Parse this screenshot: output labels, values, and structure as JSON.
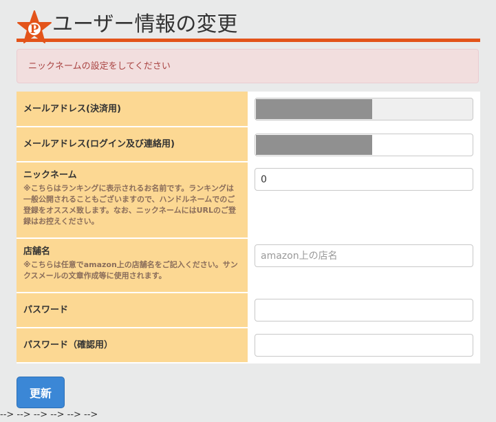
{
  "header": {
    "logo_letter": "P",
    "title": "ユーザー情報の変更"
  },
  "alert": {
    "message": "ニックネームの設定をしてください"
  },
  "form": {
    "rows": [
      {
        "label": "メールアドレス(決済用)",
        "note": "",
        "value": "",
        "placeholder": ""
      },
      {
        "label": "メールアドレス(ログイン及び連絡用)",
        "note": "",
        "value": "",
        "placeholder": ""
      },
      {
        "label": "ニックネーム",
        "note": "※こちらはランキングに表示されるお名前です。ランキングは一般公開されることもございますので、ハンドルネームでのご登録をオススメ致します。なお、ニックネームにはURLのご登録はお控えください。",
        "value": "0",
        "placeholder": ""
      },
      {
        "label": "店舗名",
        "note": "※こちらは任意でamazon上の店舗名をご記入ください。サンクスメールの文章作成等に使用されます。",
        "value": "",
        "placeholder": "amazon上の店名"
      },
      {
        "label": "パスワード",
        "note": "",
        "value": "",
        "placeholder": ""
      },
      {
        "label": "パスワード（確認用）",
        "note": "",
        "value": "",
        "placeholder": ""
      }
    ]
  },
  "actions": {
    "update_label": "更新"
  },
  "stray_text": "--> --> --> --> --> -->",
  "colors": {
    "accent": "#e3541a",
    "label_bg": "#fcd893",
    "alert_bg": "#f2dede",
    "alert_text": "#a94442",
    "button_bg": "#3b87d6"
  }
}
